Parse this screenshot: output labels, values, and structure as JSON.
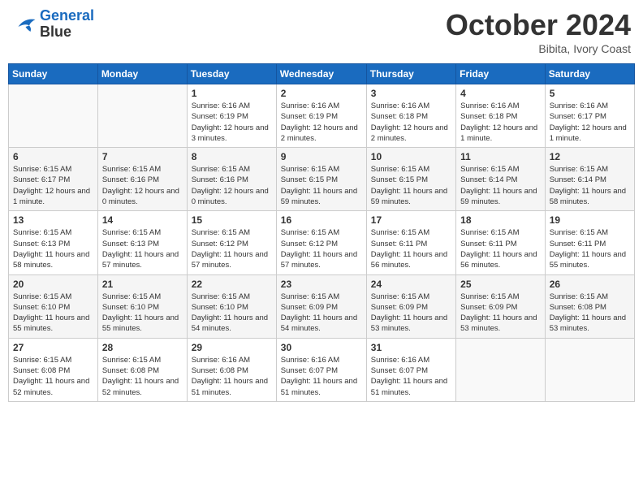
{
  "header": {
    "logo": {
      "line1": "General",
      "line2": "Blue"
    },
    "month": "October 2024",
    "location": "Bibita, Ivory Coast"
  },
  "weekdays": [
    "Sunday",
    "Monday",
    "Tuesday",
    "Wednesday",
    "Thursday",
    "Friday",
    "Saturday"
  ],
  "weeks": [
    [
      {
        "day": "",
        "info": ""
      },
      {
        "day": "",
        "info": ""
      },
      {
        "day": "1",
        "info": "Sunrise: 6:16 AM\nSunset: 6:19 PM\nDaylight: 12 hours and 3 minutes."
      },
      {
        "day": "2",
        "info": "Sunrise: 6:16 AM\nSunset: 6:19 PM\nDaylight: 12 hours and 2 minutes."
      },
      {
        "day": "3",
        "info": "Sunrise: 6:16 AM\nSunset: 6:18 PM\nDaylight: 12 hours and 2 minutes."
      },
      {
        "day": "4",
        "info": "Sunrise: 6:16 AM\nSunset: 6:18 PM\nDaylight: 12 hours and 1 minute."
      },
      {
        "day": "5",
        "info": "Sunrise: 6:16 AM\nSunset: 6:17 PM\nDaylight: 12 hours and 1 minute."
      }
    ],
    [
      {
        "day": "6",
        "info": "Sunrise: 6:15 AM\nSunset: 6:17 PM\nDaylight: 12 hours and 1 minute."
      },
      {
        "day": "7",
        "info": "Sunrise: 6:15 AM\nSunset: 6:16 PM\nDaylight: 12 hours and 0 minutes."
      },
      {
        "day": "8",
        "info": "Sunrise: 6:15 AM\nSunset: 6:16 PM\nDaylight: 12 hours and 0 minutes."
      },
      {
        "day": "9",
        "info": "Sunrise: 6:15 AM\nSunset: 6:15 PM\nDaylight: 11 hours and 59 minutes."
      },
      {
        "day": "10",
        "info": "Sunrise: 6:15 AM\nSunset: 6:15 PM\nDaylight: 11 hours and 59 minutes."
      },
      {
        "day": "11",
        "info": "Sunrise: 6:15 AM\nSunset: 6:14 PM\nDaylight: 11 hours and 59 minutes."
      },
      {
        "day": "12",
        "info": "Sunrise: 6:15 AM\nSunset: 6:14 PM\nDaylight: 11 hours and 58 minutes."
      }
    ],
    [
      {
        "day": "13",
        "info": "Sunrise: 6:15 AM\nSunset: 6:13 PM\nDaylight: 11 hours and 58 minutes."
      },
      {
        "day": "14",
        "info": "Sunrise: 6:15 AM\nSunset: 6:13 PM\nDaylight: 11 hours and 57 minutes."
      },
      {
        "day": "15",
        "info": "Sunrise: 6:15 AM\nSunset: 6:12 PM\nDaylight: 11 hours and 57 minutes."
      },
      {
        "day": "16",
        "info": "Sunrise: 6:15 AM\nSunset: 6:12 PM\nDaylight: 11 hours and 57 minutes."
      },
      {
        "day": "17",
        "info": "Sunrise: 6:15 AM\nSunset: 6:11 PM\nDaylight: 11 hours and 56 minutes."
      },
      {
        "day": "18",
        "info": "Sunrise: 6:15 AM\nSunset: 6:11 PM\nDaylight: 11 hours and 56 minutes."
      },
      {
        "day": "19",
        "info": "Sunrise: 6:15 AM\nSunset: 6:11 PM\nDaylight: 11 hours and 55 minutes."
      }
    ],
    [
      {
        "day": "20",
        "info": "Sunrise: 6:15 AM\nSunset: 6:10 PM\nDaylight: 11 hours and 55 minutes."
      },
      {
        "day": "21",
        "info": "Sunrise: 6:15 AM\nSunset: 6:10 PM\nDaylight: 11 hours and 55 minutes."
      },
      {
        "day": "22",
        "info": "Sunrise: 6:15 AM\nSunset: 6:10 PM\nDaylight: 11 hours and 54 minutes."
      },
      {
        "day": "23",
        "info": "Sunrise: 6:15 AM\nSunset: 6:09 PM\nDaylight: 11 hours and 54 minutes."
      },
      {
        "day": "24",
        "info": "Sunrise: 6:15 AM\nSunset: 6:09 PM\nDaylight: 11 hours and 53 minutes."
      },
      {
        "day": "25",
        "info": "Sunrise: 6:15 AM\nSunset: 6:09 PM\nDaylight: 11 hours and 53 minutes."
      },
      {
        "day": "26",
        "info": "Sunrise: 6:15 AM\nSunset: 6:08 PM\nDaylight: 11 hours and 53 minutes."
      }
    ],
    [
      {
        "day": "27",
        "info": "Sunrise: 6:15 AM\nSunset: 6:08 PM\nDaylight: 11 hours and 52 minutes."
      },
      {
        "day": "28",
        "info": "Sunrise: 6:15 AM\nSunset: 6:08 PM\nDaylight: 11 hours and 52 minutes."
      },
      {
        "day": "29",
        "info": "Sunrise: 6:16 AM\nSunset: 6:08 PM\nDaylight: 11 hours and 51 minutes."
      },
      {
        "day": "30",
        "info": "Sunrise: 6:16 AM\nSunset: 6:07 PM\nDaylight: 11 hours and 51 minutes."
      },
      {
        "day": "31",
        "info": "Sunrise: 6:16 AM\nSunset: 6:07 PM\nDaylight: 11 hours and 51 minutes."
      },
      {
        "day": "",
        "info": ""
      },
      {
        "day": "",
        "info": ""
      }
    ]
  ]
}
